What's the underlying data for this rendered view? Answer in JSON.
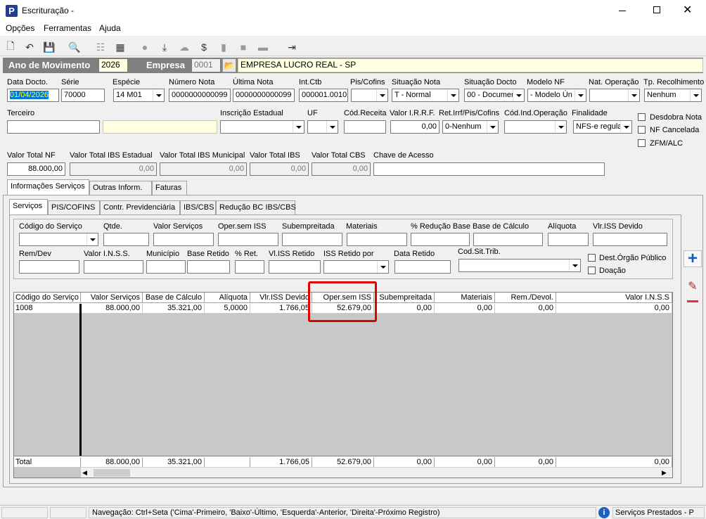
{
  "window": {
    "title": "Escrituração -",
    "app_icon": "P"
  },
  "menu": [
    "Opções",
    "Ferramentas",
    "Ajuda"
  ],
  "header": {
    "ano_label": "Ano de Movimento",
    "ano_value": "2026",
    "empresa_label": "Empresa",
    "empresa_code": "0001",
    "empresa_name": "EMPRESA LUCRO REAL - SP"
  },
  "fields": {
    "data_docto": {
      "label": "Data Docto.",
      "value": "01/04/2026"
    },
    "serie": {
      "label": "Série",
      "value": "70000"
    },
    "especie": {
      "label": "Espécie",
      "value": "14 M01"
    },
    "numero_nota": {
      "label": "Número Nota",
      "value": "0000000000099"
    },
    "ultima_nota": {
      "label": "Última Nota",
      "value": "0000000000099"
    },
    "int_ctb": {
      "label": "Int.Ctb",
      "value": "000001.0010"
    },
    "pis_cofins": {
      "label": "Pis/Cofins",
      "value": ""
    },
    "situacao_nota": {
      "label": "Situação Nota",
      "value": "T - Normal"
    },
    "situacao_docto": {
      "label": "Situação Docto",
      "value": "00 - Documer"
    },
    "modelo_nf": {
      "label": "Modelo NF",
      "value": "- Modelo Ún"
    },
    "nat_operacao": {
      "label": "Nat. Operação",
      "value": ""
    },
    "tp_recolhimento": {
      "label": "Tp. Recolhimento",
      "value": "Nenhum"
    },
    "terceiro": {
      "label": "Terceiro",
      "value": ""
    },
    "inscricao_estadual": {
      "label": "Inscrição Estadual",
      "value": ""
    },
    "uf": {
      "label": "UF",
      "value": ""
    },
    "cod_receita": {
      "label": "Cód.Receita",
      "value": ""
    },
    "valor_irrf": {
      "label": "Valor I.R.R.F.",
      "value": "0,00"
    },
    "ret_irrf": {
      "label": "Ret.Irrf/Pis/Cofins",
      "value": "0-Nenhum"
    },
    "cod_ind_operacao": {
      "label": "Cód.Ind.Operação",
      "value": ""
    },
    "finalidade": {
      "label": "Finalidade",
      "value": "NFS-e regula"
    },
    "valor_total_nf": {
      "label": "Valor Total NF",
      "value": "88.000,00"
    },
    "valor_ibs_estadual": {
      "label": "Valor Total IBS Estadual",
      "value": "0,00"
    },
    "valor_ibs_municipal": {
      "label": "Valor Total IBS Municipal",
      "value": "0,00"
    },
    "valor_ibs": {
      "label": "Valor Total IBS",
      "value": "0,00"
    },
    "valor_cbs": {
      "label": "Valor Total CBS",
      "value": "0,00"
    },
    "chave_acesso": {
      "label": "Chave de Acesso",
      "value": ""
    }
  },
  "checkboxes": {
    "desdobra_nota": "Desdobra Nota",
    "nf_cancelada": "NF Cancelada",
    "zfm_alc": "ZFM/ALC",
    "dest_orgao_publico": "Dest.Órgão Público",
    "doacao": "Doação"
  },
  "tabs_outer": [
    "Informações Serviços",
    "Outras Inform.",
    "Faturas"
  ],
  "tabs_inner": [
    "Serviços",
    "PIS/COFINS",
    "Contr. Previdenciária",
    "IBS/CBS",
    "Redução BC IBS/CBS"
  ],
  "service_form": {
    "codigo_servico": "Código do Serviço",
    "qtde": "Qtde.",
    "valor_servicos": "Valor Serviços",
    "oper_sem_iss": "Oper.sem ISS",
    "subempreitada": "Subempreitada",
    "materiais": "Materiais",
    "pct_reducao_base": "% Redução Base",
    "base_calculo": "Base de Cálculo",
    "aliquota": "Alíquota",
    "vlr_iss_devido": "Vlr.ISS Devido",
    "rem_dev": "Rem/Dev",
    "valor_inss": "Valor I.N.S.S.",
    "municipio": "Município",
    "base_retido": "Base Retido",
    "pct_ret": "% Ret.",
    "vl_iss_retido": "Vl.ISS Retido",
    "iss_retido_por": "ISS Retido por",
    "data_retido": "Data Retido",
    "cod_sit_trib": "Cod.Sit.Trib."
  },
  "grid": {
    "columns": [
      "Código do Serviço",
      "Valor Serviços",
      "Base de Cálculo",
      "Alíquota",
      "Vlr.ISS Devido",
      "Oper.sem ISS",
      "Subempreitada",
      "Materiais",
      "Rem./Devol.",
      "Valor I.N.S.S"
    ],
    "rows": [
      [
        "1008",
        "88.000,00",
        "35.321,00",
        "5,0000",
        "1.766,05",
        "52.679,00",
        "0,00",
        "0,00",
        "0,00",
        "0,00"
      ]
    ],
    "totals": [
      "Total",
      "88.000,00",
      "35.321,00",
      "",
      "1.766,05",
      "52.679,00",
      "0,00",
      "0,00",
      "0,00",
      "0,00"
    ]
  },
  "status_bar": {
    "navigation": "Navegação: Ctrl+Seta ('Cima'-Primeiro, 'Baixo'-Último, 'Esquerda'-Anterior, 'Direita'-Próximo Registro)",
    "context": "Serviços Prestados - P"
  },
  "colors": {
    "header_bar": "#808080",
    "highlight": "#e00000",
    "blue_plus": "#1060c0",
    "red_minus": "#e03030"
  }
}
